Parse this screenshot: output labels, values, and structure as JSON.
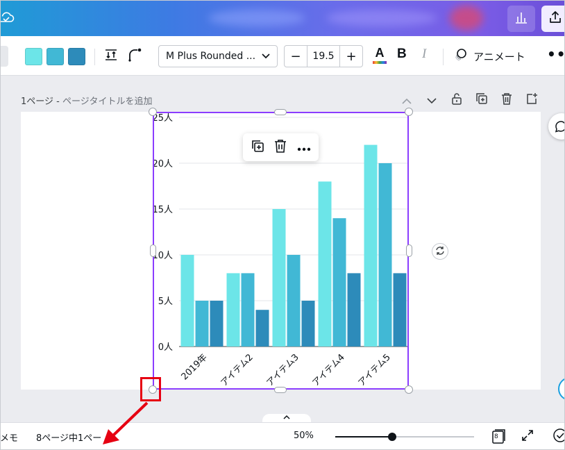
{
  "toolbar": {
    "swatches": [
      "#6ce5e8",
      "#41b8d5",
      "#2d8bba"
    ],
    "font_name": "M Plus Rounded ...",
    "font_size": "19.5",
    "minus_label": "−",
    "plus_label": "+",
    "text_color_label": "A",
    "bold_label": "B",
    "italic_label": "I",
    "animate_label": "アニメート",
    "more_label": "•••"
  },
  "page": {
    "number_label": "1ページ - ",
    "title_placeholder": "ページタイトルを追加"
  },
  "chart_data": {
    "type": "bar",
    "categories": [
      "2019年",
      "アイテム2",
      "アイテム3",
      "アイテム4",
      "アイテム5"
    ],
    "series": [
      {
        "values": [
          10,
          8,
          15,
          18,
          22
        ],
        "color": "#6ce5e8"
      },
      {
        "values": [
          5,
          8,
          10,
          14,
          20
        ],
        "color": "#41b8d5"
      },
      {
        "values": [
          5,
          4,
          5,
          8,
          8
        ],
        "color": "#2d8bba"
      }
    ],
    "yticks": [
      "0人",
      "5人",
      "10人",
      "15人",
      "20人",
      "25人"
    ],
    "ylim": [
      0,
      25
    ],
    "grid": true
  },
  "bottom": {
    "memo_label": "メモ",
    "page_count": "8ページ中1ペー",
    "zoom": "50%",
    "zoom_level": 0.41,
    "pages_badge": "8"
  }
}
